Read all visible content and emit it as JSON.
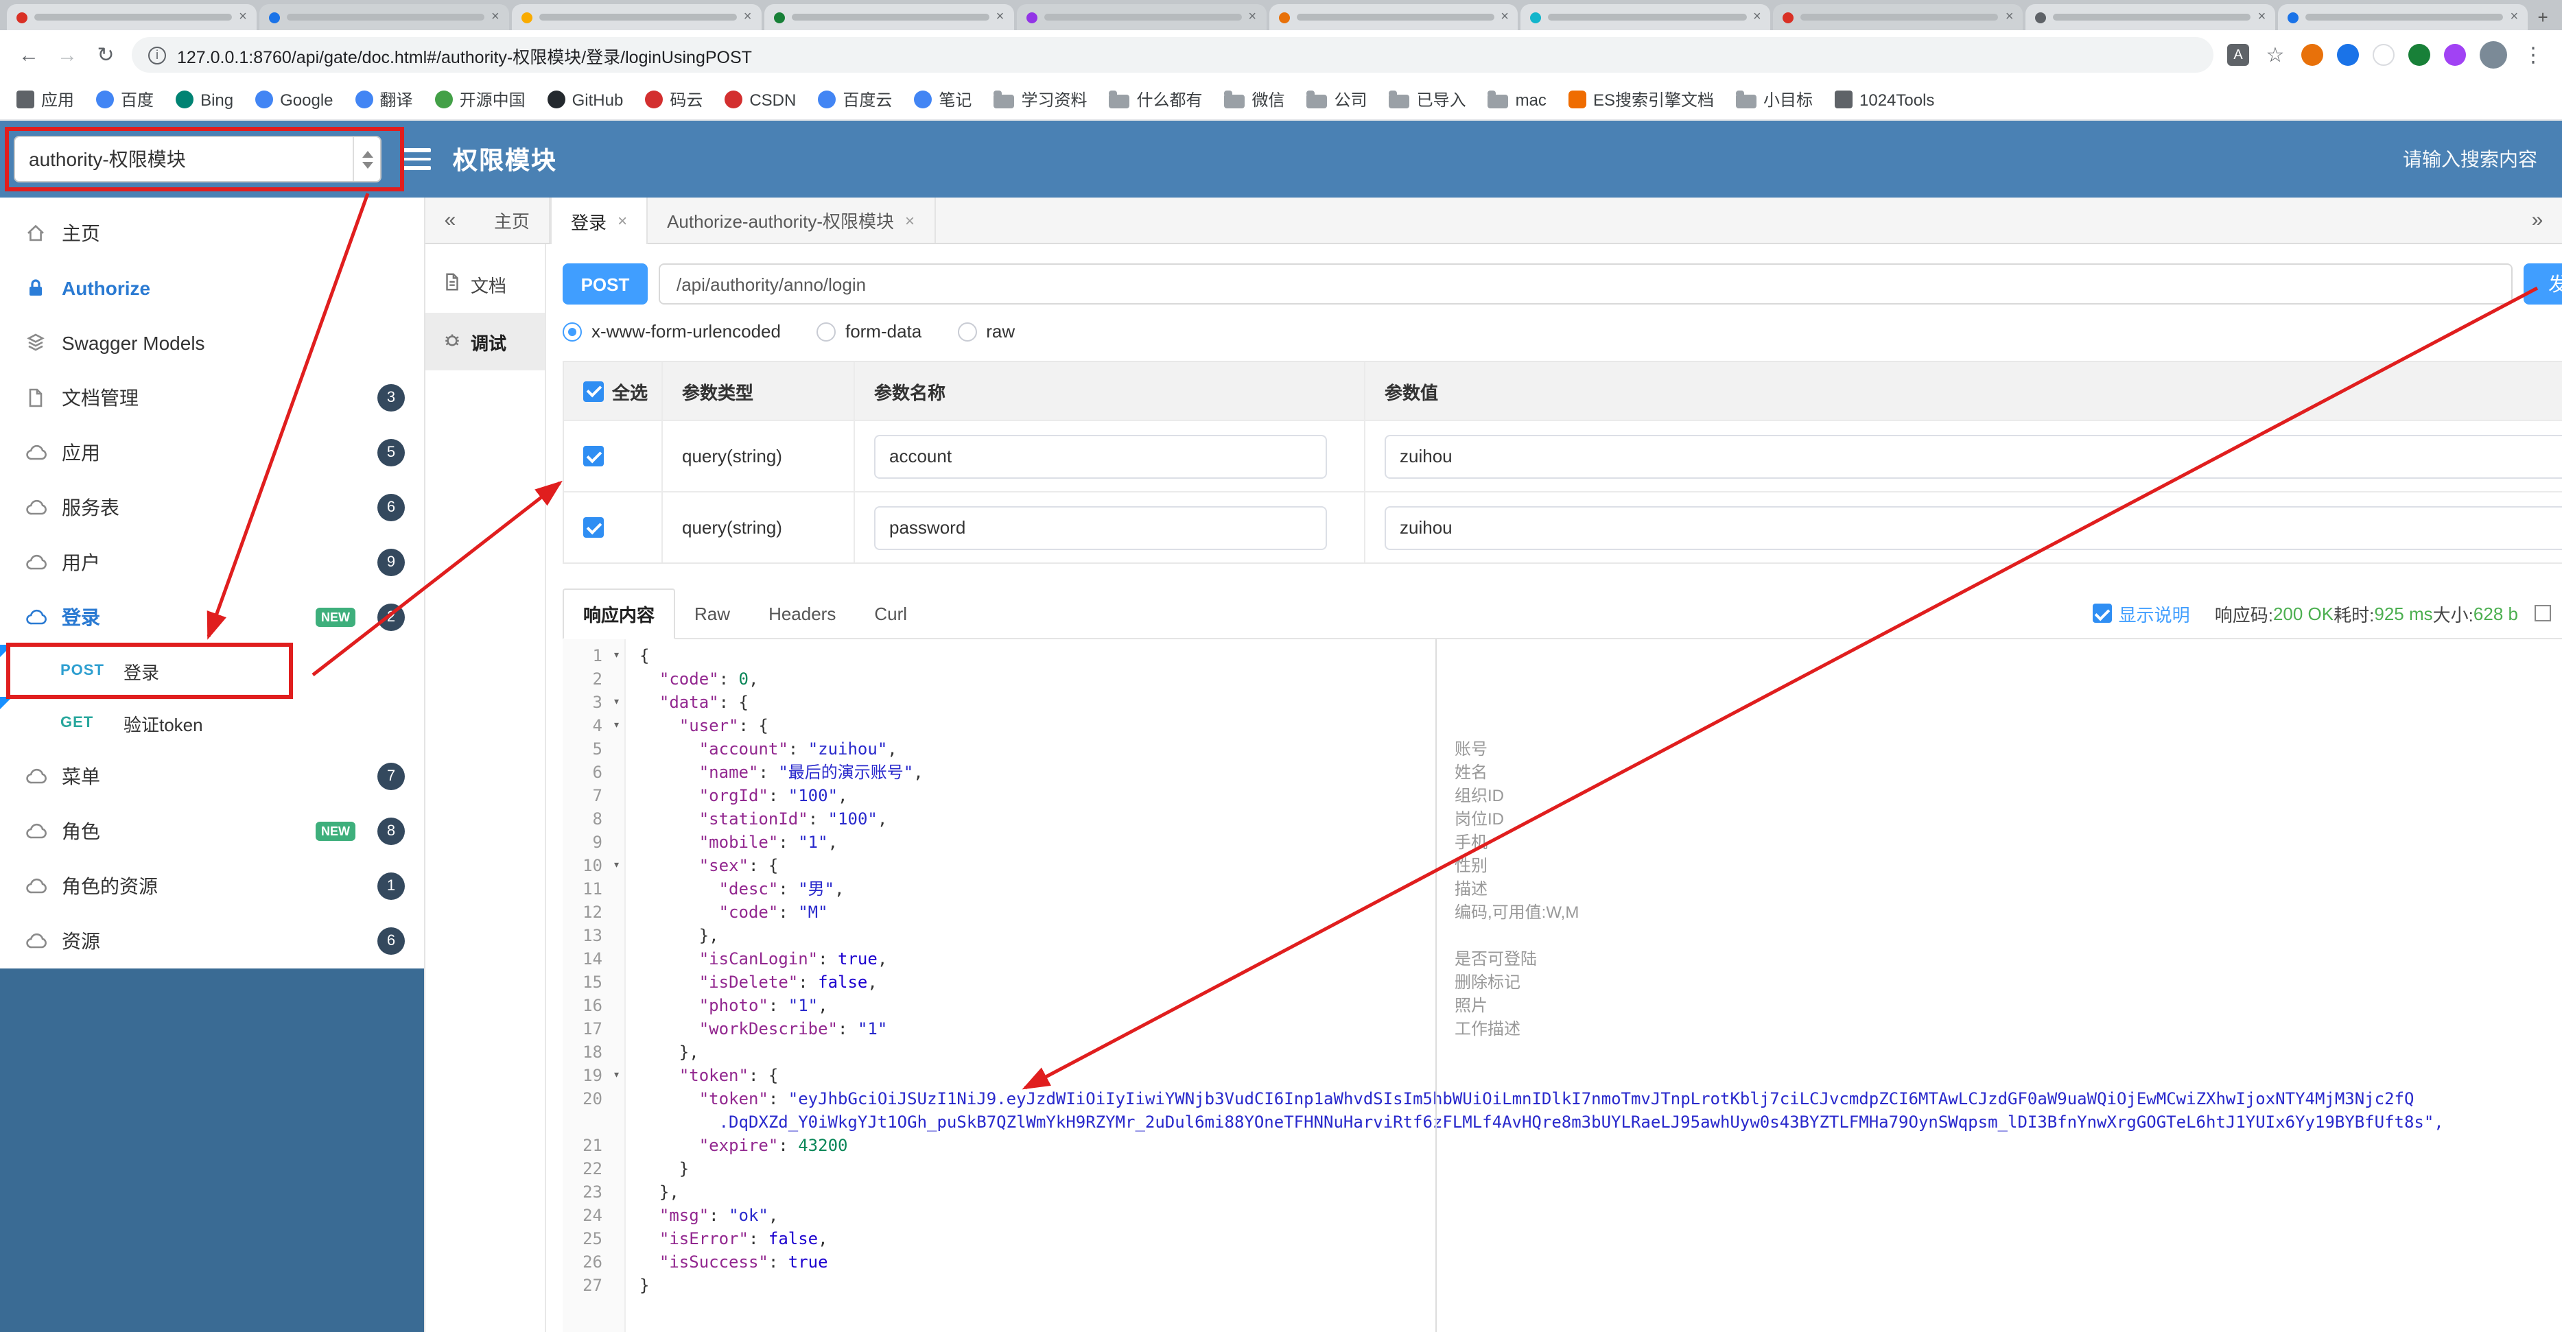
{
  "browser": {
    "url": "127.0.0.1:8760/api/gate/doc.html#/authority-权限模块/登录/loginUsingPOST",
    "bookmarks": [
      {
        "label": "应用",
        "icon": "apps"
      },
      {
        "label": "百度",
        "icon": "site-blue"
      },
      {
        "label": "Bing",
        "icon": "site-teal"
      },
      {
        "label": "Google",
        "icon": "site-blue"
      },
      {
        "label": "翻译",
        "icon": "site-blue"
      },
      {
        "label": "开源中国",
        "icon": "site-green"
      },
      {
        "label": "GitHub",
        "icon": "site-dark"
      },
      {
        "label": "码云",
        "icon": "site-red"
      },
      {
        "label": "CSDN",
        "icon": "site-red"
      },
      {
        "label": "百度云",
        "icon": "site-blue"
      },
      {
        "label": "笔记",
        "icon": "site-blue"
      },
      {
        "label": "学习资料",
        "icon": "folder"
      },
      {
        "label": "什么都有",
        "icon": "folder"
      },
      {
        "label": "微信",
        "icon": "folder"
      },
      {
        "label": "公司",
        "icon": "folder"
      },
      {
        "label": "已导入",
        "icon": "folder"
      },
      {
        "label": "mac",
        "icon": "folder"
      },
      {
        "label": "ES搜索引擎文档",
        "icon": "site-orange"
      },
      {
        "label": "小目标",
        "icon": "folder"
      },
      {
        "label": "1024Tools",
        "icon": "apps"
      }
    ]
  },
  "header": {
    "group_select_value": "authority-权限模块",
    "title": "权限模块",
    "search_placeholder": "请输入搜索内容"
  },
  "sidebar": {
    "new_badge_label": "NEW",
    "items": [
      {
        "label": "主页",
        "icon": "home-icon"
      },
      {
        "label": "Authorize",
        "icon": "lock-icon",
        "accent": true
      },
      {
        "label": "Swagger Models",
        "icon": "models-icon"
      },
      {
        "label": "文档管理",
        "icon": "docs-icon",
        "badge": "3"
      },
      {
        "label": "应用",
        "icon": "cloud-icon",
        "badge": "5"
      },
      {
        "label": "服务表",
        "icon": "cloud-icon",
        "badge": "6"
      },
      {
        "label": "用户",
        "icon": "cloud-icon",
        "badge": "9"
      },
      {
        "label": "登录",
        "icon": "cloud-icon",
        "badge": "2",
        "is_new": true,
        "accent": true
      },
      {
        "label": "菜单",
        "icon": "cloud-icon",
        "badge": "7"
      },
      {
        "label": "角色",
        "icon": "cloud-icon",
        "badge": "8",
        "is_new": true
      },
      {
        "label": "角色的资源",
        "icon": "cloud-icon",
        "badge": "1"
      },
      {
        "label": "资源",
        "icon": "cloud-icon",
        "badge": "6"
      }
    ],
    "login_children": [
      {
        "method": "POST",
        "label": "登录"
      },
      {
        "method": "GET",
        "label": "验证token"
      }
    ]
  },
  "doc_tabs": {
    "collapse_icon": "«",
    "expand_icon": "»",
    "tabs": [
      {
        "label": "主页",
        "closable": false
      },
      {
        "label": "登录",
        "closable": true,
        "active": true
      },
      {
        "label": "Authorize-authority-权限模块",
        "closable": true
      }
    ]
  },
  "side_tabs": [
    {
      "label": "文档",
      "icon": "doc-icon"
    },
    {
      "label": "调试",
      "icon": "debug-icon",
      "active": true
    }
  ],
  "request": {
    "method": "POST",
    "path": "/api/authority/anno/login",
    "send_label": "发送"
  },
  "content_type": {
    "options": [
      "x-www-form-urlencoded",
      "form-data",
      "raw"
    ],
    "selected": "x-www-form-urlencoded"
  },
  "params_table": {
    "headers": [
      "全选",
      "参数类型",
      "参数名称",
      "参数值"
    ],
    "rows": [
      {
        "checked": true,
        "type": "query(string)",
        "name": "account",
        "value": "zuihou"
      },
      {
        "checked": true,
        "type": "query(string)",
        "name": "password",
        "value": "zuihou"
      }
    ]
  },
  "response": {
    "tabs": [
      {
        "label": "响应内容",
        "active": true
      },
      {
        "label": "Raw"
      },
      {
        "label": "Headers"
      },
      {
        "label": "Curl"
      }
    ],
    "show_desc_label": "显示说明",
    "meta": {
      "code_label": "响应码:",
      "code_value": "200 OK",
      "time_label": "耗时:",
      "time_value": "925 ms",
      "size_label": "大小:",
      "size_value": "628 b"
    },
    "code_lines": [
      {
        "n": "1",
        "fold": true,
        "text": "{"
      },
      {
        "n": "2",
        "text": "  \"code\": 0,"
      },
      {
        "n": "3",
        "fold": true,
        "text": "  \"data\": {"
      },
      {
        "n": "4",
        "fold": true,
        "text": "    \"user\": {"
      },
      {
        "n": "5",
        "text": "      \"account\": \"zuihou\","
      },
      {
        "n": "6",
        "text": "      \"name\": \"最后的演示账号\","
      },
      {
        "n": "7",
        "text": "      \"orgId\": \"100\","
      },
      {
        "n": "8",
        "text": "      \"stationId\": \"100\","
      },
      {
        "n": "9",
        "text": "      \"mobile\": \"1\","
      },
      {
        "n": "10",
        "fold": true,
        "text": "      \"sex\": {"
      },
      {
        "n": "11",
        "text": "        \"desc\": \"男\","
      },
      {
        "n": "12",
        "text": "        \"code\": \"M\""
      },
      {
        "n": "13",
        "text": "      },"
      },
      {
        "n": "14",
        "text": "      \"isCanLogin\": true,"
      },
      {
        "n": "15",
        "text": "      \"isDelete\": false,"
      },
      {
        "n": "16",
        "text": "      \"photo\": \"1\","
      },
      {
        "n": "17",
        "text": "      \"workDescribe\": \"1\""
      },
      {
        "n": "18",
        "text": "    },"
      },
      {
        "n": "19",
        "fold": true,
        "text": "    \"token\": {"
      },
      {
        "n": "20",
        "text": "      \"token\": \"eyJhbGciOiJSUzI1NiJ9.eyJzdWIiOiIyIiwiYWNjb3VudCI6Inp1aWhvdSIsIm5hbWUiOiLmnIDlkI7nmoTmvJTnpLrotKblj7ciLCJvcmdpZCI6MTAwLCJzdGF0aW9uaWQiOjEwMCwiZXhwIjoxNTY4MjM3Njc2fQ"
      },
      {
        "n": "",
        "cont": true,
        "text": "        .DqDXZd_Y0iWkgYJt1OGh_puSkB7QZlWmYkH9RZYMr_2uDul6mi88YOneTFHNNuHarviRtf6zFLMLf4AvHQre8m3bUYLRaeLJ95awhUyw0s43BYZTLFMHa79OynSWqpsm_lDI3BfnYnwXrgGOGTeL6htJ1YUIx6Yy19BYBfUft8s\","
      },
      {
        "n": "21",
        "text": "      \"expire\": 43200"
      },
      {
        "n": "22",
        "text": "    }"
      },
      {
        "n": "23",
        "text": "  },"
      },
      {
        "n": "24",
        "text": "  \"msg\": \"ok\","
      },
      {
        "n": "25",
        "text": "  \"isError\": false,"
      },
      {
        "n": "26",
        "text": "  \"isSuccess\": true"
      },
      {
        "n": "27",
        "text": "}"
      }
    ],
    "field_notes": [
      {
        "row": 5,
        "text": "账号"
      },
      {
        "row": 6,
        "text": "姓名"
      },
      {
        "row": 7,
        "text": "组织ID"
      },
      {
        "row": 8,
        "text": "岗位ID"
      },
      {
        "row": 9,
        "text": "手机"
      },
      {
        "row": 10,
        "text": "性别"
      },
      {
        "row": 11,
        "text": "描述"
      },
      {
        "row": 12,
        "text": "编码,可用值:W,M"
      },
      {
        "row": 14,
        "text": "是否可登陆"
      },
      {
        "row": 15,
        "text": "删除标记"
      },
      {
        "row": 16,
        "text": "照片"
      },
      {
        "row": 17,
        "text": "工作描述"
      }
    ]
  }
}
